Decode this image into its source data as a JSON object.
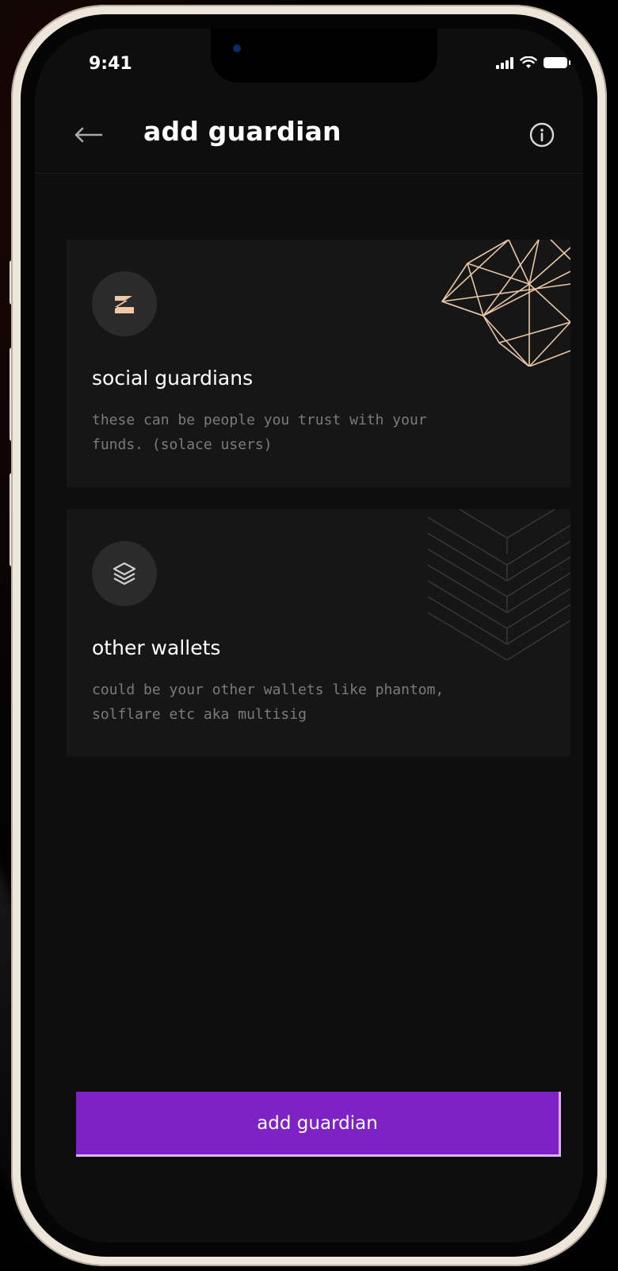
{
  "status_bar": {
    "time": "9:41"
  },
  "header": {
    "back_icon": "arrow-left-icon",
    "title": "add guardian",
    "info_icon": "info-circle-icon"
  },
  "options": [
    {
      "icon": "solace-s-logo-icon",
      "title": "social guardians",
      "description": "these can be people you trust with your funds. (solace users)",
      "accent": "#f0c8a8"
    },
    {
      "icon": "layers-icon",
      "title": "other wallets",
      "description": "could be your other wallets like phantom, solflare etc aka multisig"
    }
  ],
  "primary_action": {
    "label": "add guardian",
    "color": "#7e22c6"
  },
  "theme": {
    "screen_bg": "#0e0e0e",
    "card_bg": "#161616",
    "text": "#ffffff",
    "muted_text": "#7b7b7b",
    "frame": "#efe6db"
  }
}
